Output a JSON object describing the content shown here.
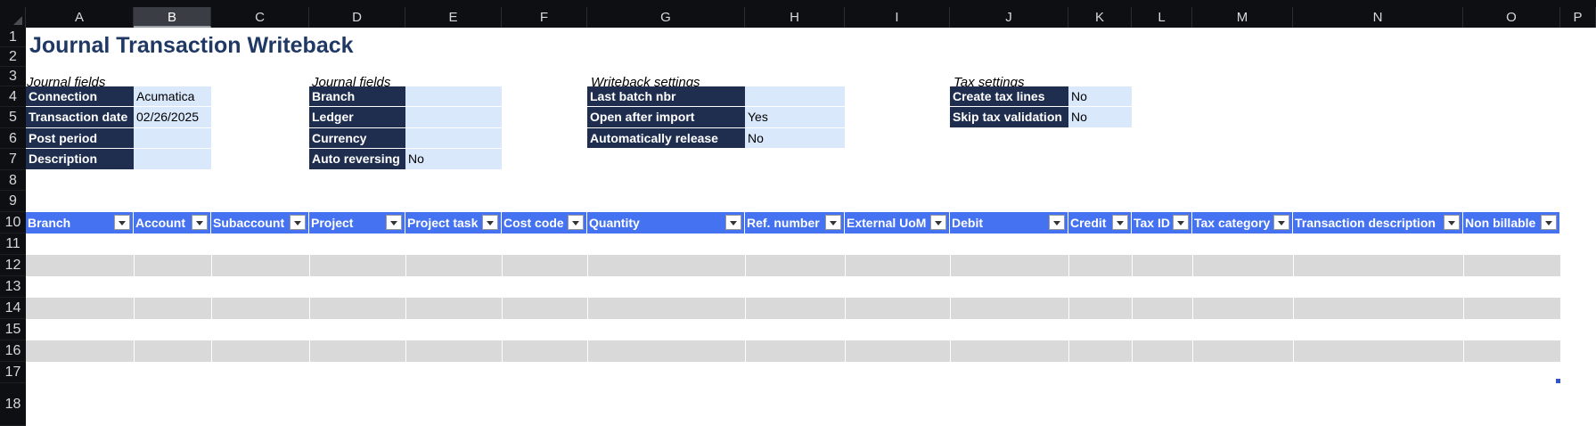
{
  "columns": [
    "A",
    "B",
    "C",
    "D",
    "E",
    "F",
    "G",
    "H",
    "I",
    "J",
    "K",
    "L",
    "M",
    "N",
    "O",
    "P"
  ],
  "selected_column": "B",
  "rows": [
    "1",
    "2",
    "3",
    "4",
    "5",
    "6",
    "7",
    "8",
    "9",
    "10",
    "11",
    "12",
    "13",
    "14",
    "15",
    "16",
    "17",
    "18"
  ],
  "title": "Journal Transaction Writeback",
  "journal_fields_1": {
    "heading": "Journal fields",
    "items": [
      {
        "label": "Connection",
        "value": "Acumatica"
      },
      {
        "label": "Transaction date",
        "value": "02/26/2025"
      },
      {
        "label": "Post period",
        "value": ""
      },
      {
        "label": "Description",
        "value": ""
      }
    ]
  },
  "journal_fields_2": {
    "heading": "Journal fields",
    "items": [
      {
        "label": "Branch",
        "value": ""
      },
      {
        "label": "Ledger",
        "value": ""
      },
      {
        "label": "Currency",
        "value": ""
      },
      {
        "label": "Auto reversing",
        "value": "No"
      }
    ]
  },
  "writeback_settings": {
    "heading": "Writeback settings",
    "items": [
      {
        "label": "Last batch nbr",
        "value": ""
      },
      {
        "label": "Open after import",
        "value": "Yes"
      },
      {
        "label": "Automatically release",
        "value": "No"
      }
    ]
  },
  "tax_settings": {
    "heading": "Tax settings",
    "items": [
      {
        "label": "Create tax lines",
        "value": "No"
      },
      {
        "label": "Skip tax validation",
        "value": "No"
      }
    ]
  },
  "table_headers": [
    "Branch",
    "Account",
    "Subaccount",
    "Project",
    "Project task",
    "Cost code",
    "Quantity",
    "Ref. number",
    "External UoM",
    "Debit",
    "Credit",
    "Tax ID",
    "Tax category",
    "Transaction description",
    "Non billable"
  ],
  "colors": {
    "label_bg": "#1f2d4e",
    "value_bg": "#dae8fc",
    "table_header_bg": "#4472f0",
    "band_grey": "#d9d9d9",
    "title": "#1f3864"
  }
}
